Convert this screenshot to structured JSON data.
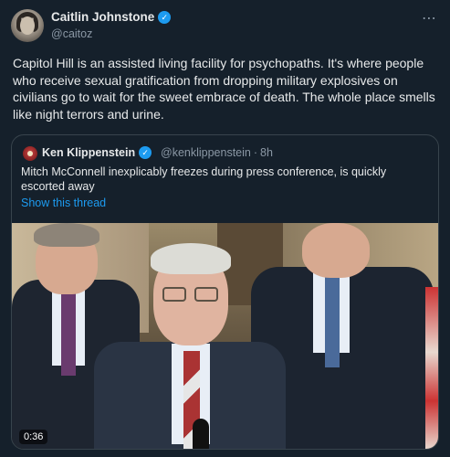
{
  "tweet": {
    "author_name": "Caitlin Johnstone",
    "author_handle": "@caitoz",
    "verified_mark": "✓",
    "more_icon": "⋯",
    "text": "Capitol Hill is an assisted living facility for psychopaths. It's where people who receive sexual gratification from dropping military explosives on civilians go to wait for the sweet embrace of death. The whole place smells like night terrors and urine."
  },
  "quoted": {
    "author_name": "Ken Klippenstein",
    "author_handle": "@kenklippenstein",
    "separator": "·",
    "time": "8h",
    "text": "Mitch McConnell inexplicably freezes during press conference, is quickly escorted away",
    "show_thread": "Show this thread",
    "video_timestamp": "0:36"
  },
  "colors": {
    "background": "#15202b",
    "accent": "#1d9bf0",
    "muted": "#8b98a5"
  },
  "icons": {
    "more": "more-horizontal-icon",
    "verified": "verified-badge-icon"
  }
}
